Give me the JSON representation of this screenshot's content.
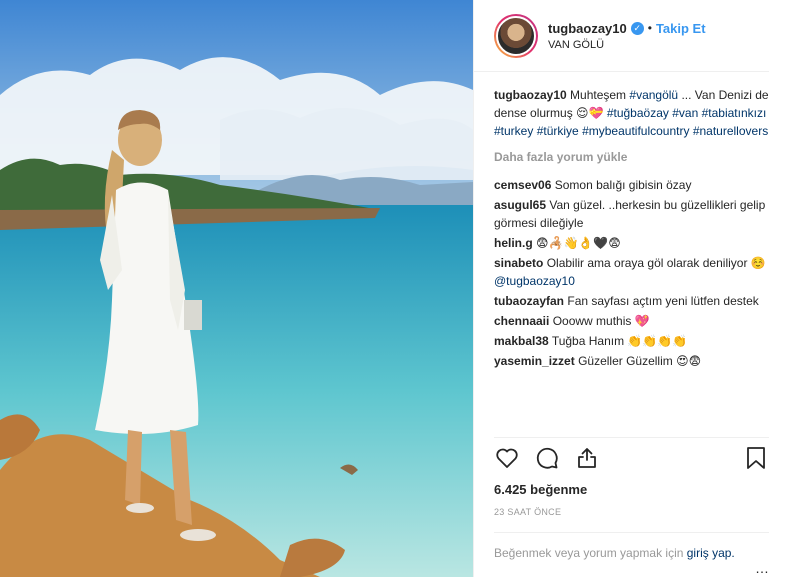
{
  "post": {
    "username": "tugbaozay10",
    "follow_label": "Takip Et",
    "location": "VAN GÖLÜ",
    "separator": "•",
    "verified_icon": "✓",
    "caption": {
      "text_1": "Muhteşem ",
      "tag_1": "#vangölü",
      "text_2": " ... Van Denizi de dense olurmuş 😌💝 ",
      "tag_2": "#tuğbaözay",
      "tag_3": "#van",
      "tag_4": "#tabiatınkızı",
      "tag_5": "#turkey",
      "tag_6": "#türkiye",
      "tag_7": "#mybeautifulcountry",
      "tag_8": "#naturellovers"
    },
    "load_more": "Daha fazla yorum yükle",
    "comments": [
      {
        "user": "cemsev06",
        "text": "Somon balığı gibisin özay"
      },
      {
        "user": "asugul65",
        "text": "Van güzel. ..herkesin bu güzellikleri gelip görmesi dileğiyle"
      },
      {
        "user": "helin.g",
        "text": "😨🦂👋👌🖤😨"
      },
      {
        "user": "sinabeto",
        "text": "Olabilir ama oraya göl olarak deniliyor ☺️ ",
        "mention": "@tugbaozay10"
      },
      {
        "user": "tubaozayfan",
        "text": "Fan sayfası açtım yeni lütfen destek"
      },
      {
        "user": "chennaaii",
        "text": "Oooww muthis 💖"
      },
      {
        "user": "makbal38",
        "text": "Tuğba Hanım 👏👏👏👏"
      },
      {
        "user": "yasemin_izzet",
        "text": "Güzeller Güzellim 😍😨"
      }
    ],
    "likes": "6.425 beğenme",
    "time": "23 SAAT ÖNCE",
    "login_prompt": "Beğenmek veya yorum yapmak için ",
    "login_link": "giriş yap.",
    "more_icon": "…"
  },
  "colors": {
    "link": "#003569",
    "accent": "#3897f0",
    "muted": "#999999"
  },
  "icons": [
    "heart-icon",
    "comment-icon",
    "share-icon",
    "bookmark-icon",
    "verified-icon",
    "more-icon"
  ]
}
